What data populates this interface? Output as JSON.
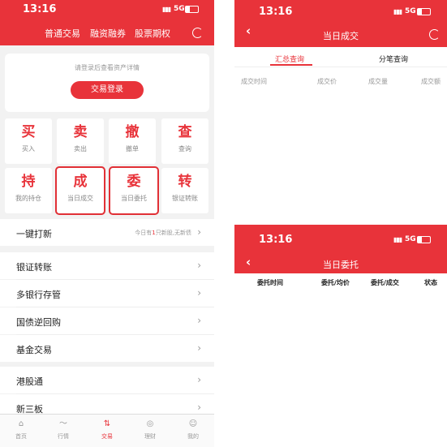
{
  "status_bar": {
    "time": "13:16",
    "signal": "▮▮▮",
    "network": "5G"
  },
  "left": {
    "top_nav": [
      "普通交易",
      "融资融券",
      "股票期权"
    ],
    "login": {
      "hint": "请登录后查看资产详情",
      "button": "交易登录"
    },
    "grid": [
      {
        "big": "买",
        "small": "买入"
      },
      {
        "big": "卖",
        "small": "卖出"
      },
      {
        "big": "撤",
        "small": "撤单"
      },
      {
        "big": "查",
        "small": "查询"
      },
      {
        "big": "持",
        "small": "我的持仓"
      },
      {
        "big": "成",
        "small": "当日成交"
      },
      {
        "big": "委",
        "small": "当日委托"
      },
      {
        "big": "转",
        "small": "银证转账"
      }
    ],
    "ipo": {
      "label": "一键打新",
      "side_pre": "今日有",
      "side_num": "1",
      "side_post": "只新股,无新债"
    },
    "menu1": [
      "银证转账",
      "多银行存管",
      "国债逆回购",
      "基金交易"
    ],
    "menu2": [
      "港股通",
      "新三板"
    ],
    "tabs": [
      "首页",
      "行情",
      "交易",
      "理财",
      "我的"
    ]
  },
  "right_top": {
    "title": "当日成交",
    "segments": [
      "汇总查询",
      "分笔查询"
    ],
    "columns": [
      "成交时间",
      "成交价",
      "成交量",
      "成交额"
    ]
  },
  "right_bottom": {
    "title": "当日委托",
    "columns": [
      "委托时间",
      "委托/均价",
      "委托/成交",
      "状态"
    ]
  },
  "icons": {
    "back": "‹",
    "chevron": "›",
    "refresh": "refresh-icon",
    "tab_icons": [
      "home-icon",
      "chart-icon",
      "trade-icon",
      "wealth-icon",
      "profile-icon"
    ]
  },
  "colors": {
    "accent": "#e8333a",
    "background": "#f2f2f2"
  }
}
